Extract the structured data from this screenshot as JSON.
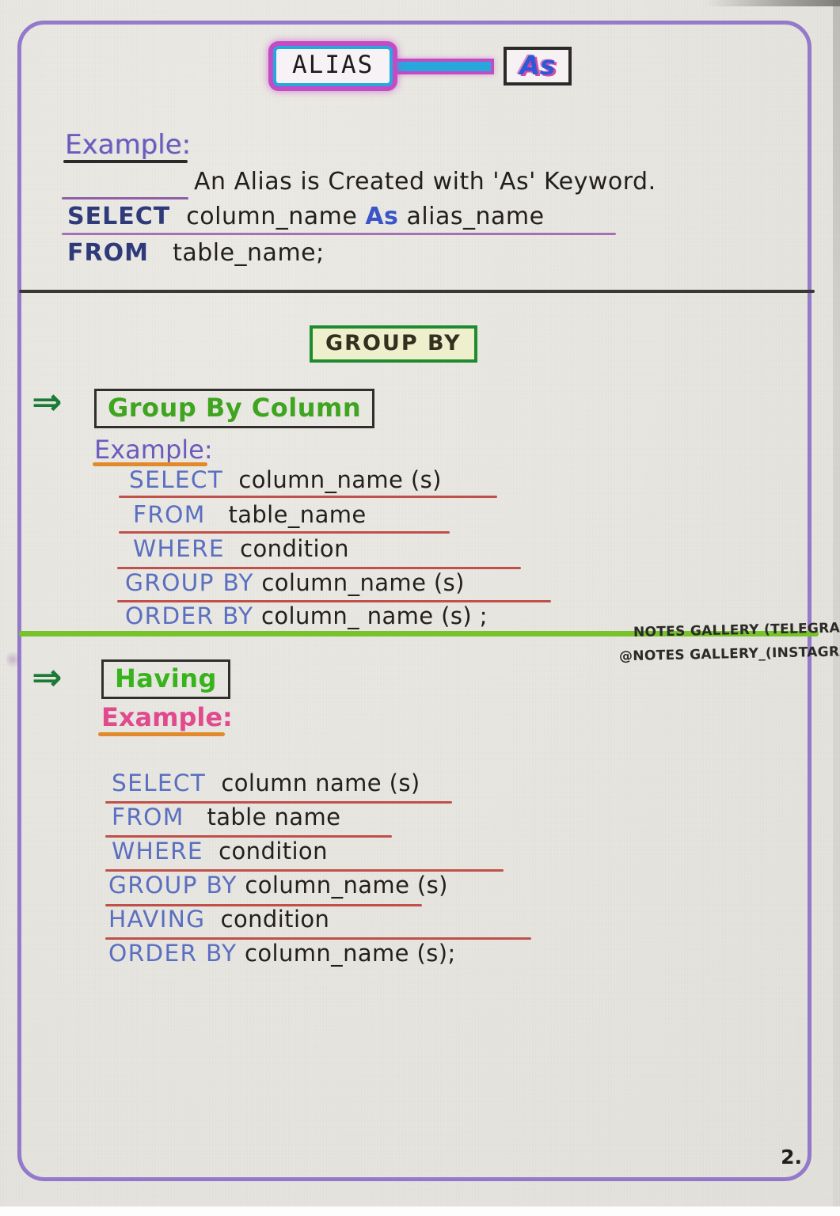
{
  "page": {
    "number": "2.",
    "border_color": "#8a6ec4",
    "paper_color": "#e8e6e1"
  },
  "title": {
    "main_box": "ALIAS",
    "linked_box": "As",
    "main_box_border_color": "#26a8dd",
    "main_box_glow_color": "#c34bc4",
    "linked_box_border_color": "#2b2a28",
    "linked_text_color": "#2b59d8"
  },
  "section_alias": {
    "example_label": "Example:",
    "sentence": "An Alias is Created with 'As' Keyword.",
    "lines": [
      {
        "keyword": "SELECT",
        "rest_a": "column_name ",
        "highlight": "As",
        "rest_b": " alias_name",
        "underline": true
      },
      {
        "keyword": "FROM",
        "rest_a": "table_name;",
        "highlight": "",
        "rest_b": "",
        "underline": false
      }
    ]
  },
  "section_groupby": {
    "heading": "GROUP BY",
    "heading_border_color": "#1f8b2e",
    "heading_fill_color": "#eef0cd",
    "items": [
      {
        "arrow": "⇒",
        "title": "Group By Column",
        "title_color": "#3fa520",
        "example_label": "Example:",
        "example_label_color": "#6b5bbd",
        "example_underline_color": "#e08a2c",
        "code": [
          {
            "keyword": "SELECT",
            "value": "column_name (s)"
          },
          {
            "keyword": "FROM",
            "value": "table_name"
          },
          {
            "keyword": "WHERE",
            "value": "condition"
          },
          {
            "keyword": "GROUP BY",
            "value": "column_name (s)"
          },
          {
            "keyword": "ORDER BY",
            "value": "column_ name (s) ;"
          }
        ]
      },
      {
        "arrow": "⇒",
        "title": "Having",
        "title_color": "#37b31b",
        "example_label": "Example:",
        "example_label_color": "#e24a8e",
        "example_underline_color": "#e08a2c",
        "code": [
          {
            "keyword": "SELECT",
            "value": "column name (s)"
          },
          {
            "keyword": "FROM",
            "value": "table name"
          },
          {
            "keyword": "WHERE",
            "value": "condition"
          },
          {
            "keyword": "GROUP BY",
            "value": "column_name (s)"
          },
          {
            "keyword": "HAVING",
            "value": "condition"
          },
          {
            "keyword": "ORDER BY",
            "value": "column_name (s);"
          }
        ]
      }
    ]
  },
  "watermark": {
    "line1": "NOTES GALLERY (TELEGRAM)",
    "line2": "@NOTES GALLERY_(INSTAGRAM)"
  },
  "dividers": {
    "black_color": "#3a3833",
    "green_color": "#77c32b"
  }
}
